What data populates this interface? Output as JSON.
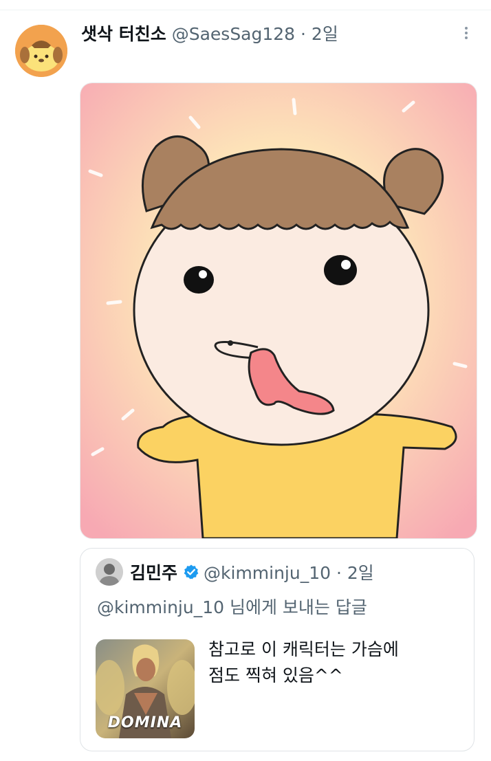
{
  "tweet": {
    "author_name": "샛삭 터친소",
    "author_handle_time": "@SaesSag128 · 2일",
    "avatar_icon": "pompompurin-avatar-icon",
    "more_icon": "more-options-icon"
  },
  "quoted": {
    "author_name": "김민주",
    "author_handle_time": "@kimminju_10 · 2일",
    "verified_icon": "verified-badge-icon",
    "reply_line": "@kimminju_10 님에게 보내는 답글",
    "text_line1": "참고로 이 캐릭터는 가슴에",
    "text_line2": "점도 찍혀 있음^^",
    "thumbnail_label": "DOMINA"
  },
  "colors": {
    "handle_gray": "#536471",
    "verified_blue": "#1d9bf0",
    "border": "#dfe3e6"
  }
}
